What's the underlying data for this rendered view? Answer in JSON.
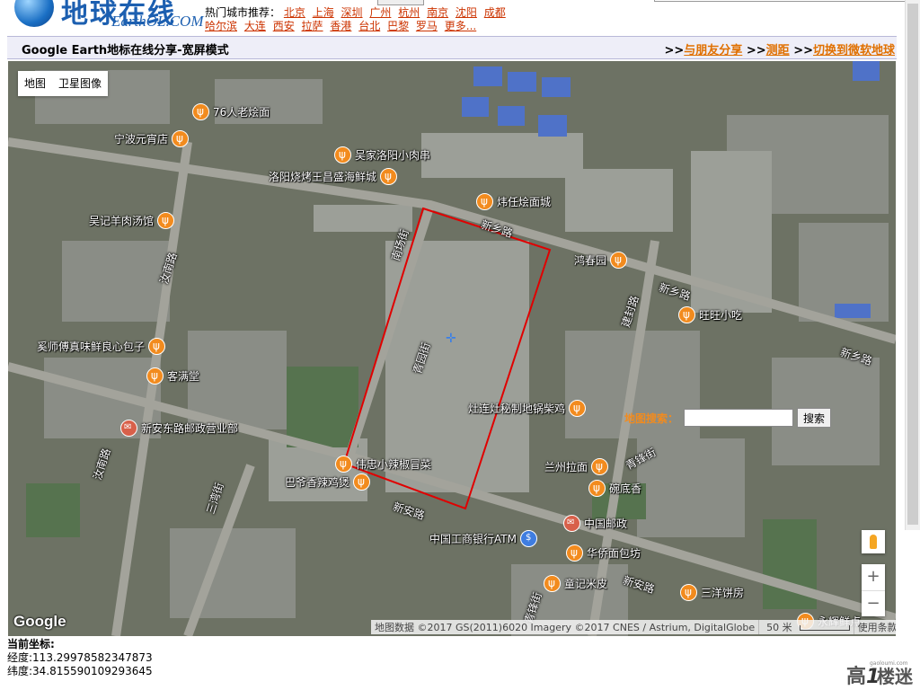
{
  "header": {
    "logo_cn": "地球在线",
    "logo_en": "EarthOL.COM",
    "hot_label": "热门城市推荐：",
    "cities": [
      "北京",
      "上海",
      "深圳",
      "广州",
      "杭州",
      "南京",
      "沈阳",
      "成都",
      "哈尔滨",
      "大连",
      "西安",
      "拉萨",
      "香港",
      "台北",
      "巴黎",
      "罗马",
      "更多..."
    ]
  },
  "titlebar": {
    "title": "Google Earth地标在线分享-宽屏模式",
    "prefix1": ">>",
    "link1": "与朋友分享",
    "prefix2": ">>",
    "link2": "测距",
    "prefix3": ">>",
    "link3": "切换到微软地球"
  },
  "map": {
    "type_map": "地图",
    "type_satellite": "卫星图像",
    "pois": [
      {
        "name": "76人老烩面",
        "icon": "restaurant-icon",
        "side": "right"
      },
      {
        "name": "宁波元宵店",
        "icon": "restaurant-icon",
        "side": "left"
      },
      {
        "name": "吴家洛阳小肉串",
        "icon": "restaurant-icon",
        "side": "right"
      },
      {
        "name": "洛阳烧烤王昌盛海鲜城",
        "icon": "restaurant-icon",
        "side": "left"
      },
      {
        "name": "炜任烩面城",
        "icon": "restaurant-icon",
        "side": "right"
      },
      {
        "name": "吴记羊肉汤馆",
        "icon": "restaurant-icon",
        "side": "left"
      },
      {
        "name": "鸿春园",
        "icon": "restaurant-icon",
        "side": "left"
      },
      {
        "name": "旺旺小吃",
        "icon": "restaurant-icon",
        "side": "right"
      },
      {
        "name": "奚师傅真味鲜良心包子",
        "icon": "restaurant-icon",
        "side": "left"
      },
      {
        "name": "客满堂",
        "icon": "restaurant-icon",
        "side": "right"
      },
      {
        "name": "灶连灶秘制地锅柴鸡",
        "icon": "restaurant-icon",
        "side": "left"
      },
      {
        "name": "新安东路邮政营业部",
        "icon": "mail-icon",
        "side": "right"
      },
      {
        "name": "伟忠小辣椒冒菜",
        "icon": "restaurant-icon",
        "side": "right"
      },
      {
        "name": "巴爷香辣鸡煲",
        "icon": "restaurant-icon",
        "side": "left"
      },
      {
        "name": "兰州拉面",
        "icon": "restaurant-icon",
        "side": "left"
      },
      {
        "name": "碗底香",
        "icon": "restaurant-icon",
        "side": "right"
      },
      {
        "name": "中国邮政",
        "icon": "mail-icon",
        "side": "right"
      },
      {
        "name": "中国工商银行ATM",
        "icon": "atm-icon",
        "side": "left"
      },
      {
        "name": "华侨面包坊",
        "icon": "restaurant-icon",
        "side": "right"
      },
      {
        "name": "童记米皮",
        "icon": "restaurant-icon",
        "side": "right"
      },
      {
        "name": "三洋饼房",
        "icon": "restaurant-icon",
        "side": "right"
      },
      {
        "name": "永辉鲜点",
        "icon": "restaurant-icon",
        "side": "right"
      }
    ],
    "roads": [
      "新乡路",
      "新乡路",
      "新乡路",
      "青锋街",
      "汝南路",
      "汝南路",
      "三湾街",
      "新安路",
      "新安路",
      "青园街",
      "南场街",
      "建封路",
      "青锋街"
    ],
    "search_label": "地图搜索：",
    "search_value": "",
    "search_button": "搜索",
    "zoom_in": "+",
    "zoom_out": "−",
    "google_logo": "Google",
    "attribution": "地图数据 ©2017 GS(2011)6020 Imagery ©2017 CNES / Astrium, DigitalGlobe",
    "scale_label": "50 米",
    "terms": "使用条款"
  },
  "coords": {
    "heading": "当前坐标:",
    "lng_label": "经度:",
    "lng": "113.29978582347873",
    "lat_label": "纬度:",
    "lat": "34.815590109293645"
  },
  "watermark": "高楼迷 gaoloumi.com"
}
